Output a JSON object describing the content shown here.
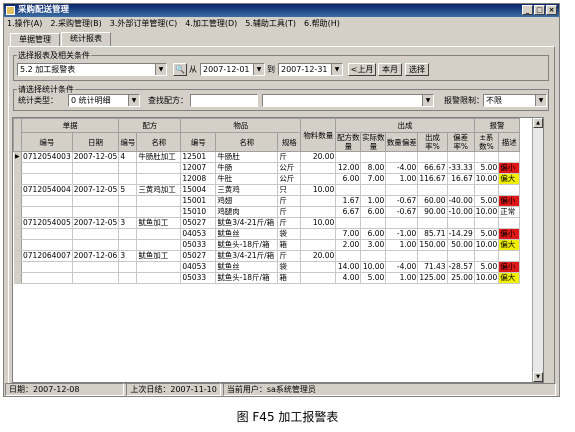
{
  "window": {
    "title": "采购配送管理",
    "min": "_",
    "max": "□",
    "close": "×"
  },
  "menu": [
    "1.操作(A)",
    "2.采购管理(B)",
    "3.外部订单管理(C)",
    "4.加工管理(D)",
    "5.辅助工具(T)",
    "6.帮助(H)"
  ],
  "tabs": [
    "单据管理",
    "统计报表"
  ],
  "report_group": {
    "legend": "选择报表及相关条件",
    "report": "5.2 加工报警表",
    "from_label": "从",
    "date_from": "2007-12-01",
    "to_label": "到",
    "date_to": "2007-12-31",
    "prev_month": "<上月",
    "this_month": "本月",
    "select": "选择"
  },
  "filter_group": {
    "legend": "请选择统计条件",
    "type_label": "统计类型：",
    "type_value": "0 统计明细",
    "recipe_label": "查找配方：",
    "recipe_value": "",
    "alarm_label": "报警限制：",
    "alarm_value": "不限"
  },
  "grid": {
    "group_headers": {
      "doc": "单据",
      "recipe": "配方",
      "goods": "物品",
      "material_qty": "物料数量",
      "output": "出成",
      "alarm": "报警"
    },
    "columns": [
      "编号",
      "日期",
      "编号",
      "名称",
      "编号",
      "名称",
      "规格",
      "",
      "配方数量",
      "实际数量",
      "数量偏差",
      "出成率%",
      "偏差率%",
      "±系数%",
      "描述"
    ],
    "rows": [
      [
        "0712054003",
        "2007-12-05",
        "4",
        "牛肠肚加工",
        "12501",
        "牛肠肚",
        "斤",
        "20.00",
        "",
        "",
        "",
        "",
        "",
        "",
        ""
      ],
      [
        "",
        "",
        "",
        "",
        "12007",
        "牛肠",
        "公斤",
        "",
        "12.00",
        "8.00",
        "-4.00",
        "66.67",
        "-33.33",
        "5.00",
        "偏小"
      ],
      [
        "",
        "",
        "",
        "",
        "12008",
        "牛肚",
        "公斤",
        "",
        "6.00",
        "7.00",
        "1.00",
        "116.67",
        "16.67",
        "10.00",
        "偏大"
      ],
      [
        "0712054004",
        "2007-12-05",
        "5",
        "三黄鸡加工",
        "15004",
        "三黄鸡",
        "只",
        "10.00",
        "",
        "",
        "",
        "",
        "",
        "",
        ""
      ],
      [
        "",
        "",
        "",
        "",
        "15001",
        "鸡翅",
        "斤",
        "",
        "1.67",
        "1.00",
        "-0.67",
        "60.00",
        "-40.00",
        "5.00",
        "偏小"
      ],
      [
        "",
        "",
        "",
        "",
        "15010",
        "鸡腿肉",
        "斤",
        "",
        "6.67",
        "6.00",
        "-0.67",
        "90.00",
        "-10.00",
        "10.00",
        "正常"
      ],
      [
        "0712054005",
        "2007-12-05",
        "3",
        "鱿鱼加工",
        "05027",
        "鱿鱼3/4-21斤/箱",
        "斤",
        "10.00",
        "",
        "",
        "",
        "",
        "",
        "",
        ""
      ],
      [
        "",
        "",
        "",
        "",
        "04053",
        "鱿鱼丝",
        "袋",
        "",
        "7.00",
        "6.00",
        "-1.00",
        "85.71",
        "-14.29",
        "5.00",
        "偏小"
      ],
      [
        "",
        "",
        "",
        "",
        "05033",
        "鱿鱼头-18斤/箱",
        "箱",
        "",
        "2.00",
        "3.00",
        "1.00",
        "150.00",
        "50.00",
        "10.00",
        "偏大"
      ],
      [
        "0712064007",
        "2007-12-06",
        "3",
        "鱿鱼加工",
        "05027",
        "鱿鱼3/4-21斤/箱",
        "斤",
        "20.00",
        "",
        "",
        "",
        "",
        "",
        "",
        ""
      ],
      [
        "",
        "",
        "",
        "",
        "04053",
        "鱿鱼丝",
        "袋",
        "",
        "14.00",
        "10.00",
        "-4.00",
        "71.43",
        "-28.57",
        "5.00",
        "偏小"
      ],
      [
        "",
        "",
        "",
        "",
        "05033",
        "鱿鱼头-18斤/箱",
        "箱",
        "",
        "4.00",
        "5.00",
        "1.00",
        "125.00",
        "25.00",
        "10.00",
        "偏大"
      ]
    ],
    "selected_marker": "▶"
  },
  "status": {
    "date": "日期：2007-12-08",
    "last_close": "上次日结：2007-11-10",
    "user": "当前用户：sa系统管理员"
  },
  "caption": "图 F45 加工报警表",
  "colors": {
    "alarm_low": "#e01818",
    "alarm_high": "#f0f000",
    "title_bar": "#0a246a"
  }
}
